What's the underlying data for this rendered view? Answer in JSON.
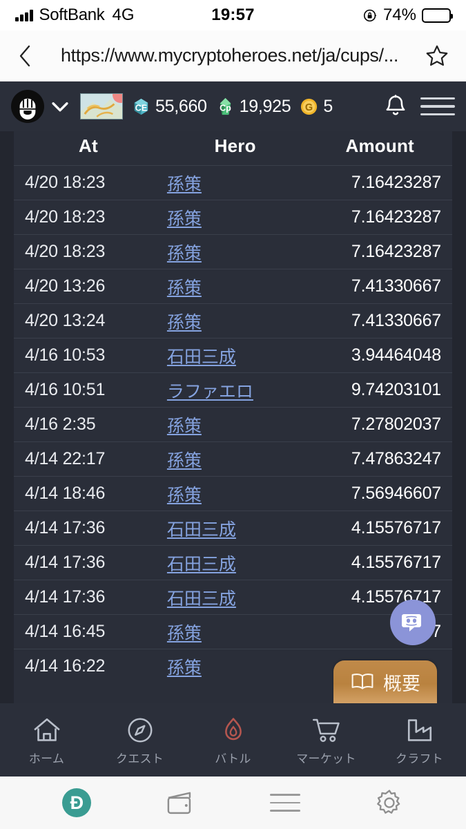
{
  "status_bar": {
    "carrier": "SoftBank",
    "network": "4G",
    "time": "19:57",
    "battery_percent": "74%"
  },
  "browser": {
    "url": "https://www.mycryptoheroes.net/ja/cups/...",
    "back_icon": "chevron-left-icon",
    "bookmark_icon": "star-icon",
    "toolbar": {
      "dapp_label": "Ð",
      "dapp_icon": "dapp-browser-icon",
      "wallet_icon": "wallet-icon",
      "menu_icon": "hamburger-menu-icon",
      "settings_icon": "gear-icon"
    }
  },
  "game_header": {
    "logo_icon": "mycryptoheroes-logo",
    "dropdown_icon": "chevron-down-icon",
    "map_thumb_icon": "land-thumbnail",
    "map_badge": "notification-dot",
    "currencies": [
      {
        "icon": "ce-crystal-icon",
        "code": "CE",
        "value": "55,660",
        "color": "#4fb5c6"
      },
      {
        "icon": "cp-crystal-icon",
        "code": "Cp",
        "value": "19,925",
        "color": "#4cbf7a"
      },
      {
        "icon": "gum-coin-icon",
        "code": "G",
        "value": "5",
        "color": "#f0b429"
      }
    ],
    "bell_icon": "notification-bell-icon",
    "menu_icon": "hamburger-menu-icon"
  },
  "table": {
    "columns": [
      "At",
      "Hero",
      "Amount"
    ],
    "rows": [
      {
        "at": "4/20 18:23",
        "hero": "孫策",
        "amount": "7.16423287"
      },
      {
        "at": "4/20 18:23",
        "hero": "孫策",
        "amount": "7.16423287"
      },
      {
        "at": "4/20 18:23",
        "hero": "孫策",
        "amount": "7.16423287"
      },
      {
        "at": "4/20 13:26",
        "hero": "孫策",
        "amount": "7.41330667"
      },
      {
        "at": "4/20 13:24",
        "hero": "孫策",
        "amount": "7.41330667"
      },
      {
        "at": "4/16 10:53",
        "hero": "石田三成",
        "amount": "3.94464048"
      },
      {
        "at": "4/16 10:51",
        "hero": "ラファエロ",
        "amount": "9.74203101"
      },
      {
        "at": "4/16 2:35",
        "hero": "孫策",
        "amount": "7.27802037"
      },
      {
        "at": "4/14 22:17",
        "hero": "孫策",
        "amount": "7.47863247"
      },
      {
        "at": "4/14 18:46",
        "hero": "孫策",
        "amount": "7.56946607"
      },
      {
        "at": "4/14 17:36",
        "hero": "石田三成",
        "amount": "4.15576717"
      },
      {
        "at": "4/14 17:36",
        "hero": "石田三成",
        "amount": "4.15576717"
      },
      {
        "at": "4/14 17:36",
        "hero": "石田三成",
        "amount": "4.15576717"
      },
      {
        "at": "4/14 16:45",
        "hero": "孫策",
        "amount": "7.687"
      },
      {
        "at": "4/14 16:22",
        "hero": "孫策",
        "amount": ""
      }
    ]
  },
  "floating": {
    "discord_icon": "discord-chat-icon",
    "overview_label": "概要",
    "overview_icon": "book-icon"
  },
  "game_nav": [
    {
      "icon": "home-icon",
      "label": "ホーム",
      "active": false
    },
    {
      "icon": "quest-icon",
      "label": "クエスト",
      "active": false
    },
    {
      "icon": "battle-icon",
      "label": "バトル",
      "active": true
    },
    {
      "icon": "market-icon",
      "label": "マーケット",
      "active": false
    },
    {
      "icon": "craft-icon",
      "label": "クラフト",
      "active": false
    }
  ],
  "colors": {
    "header_bg": "#2b2f3a",
    "page_bg": "#23262f",
    "row_bg": "#2a2e39",
    "link": "#85a3e0",
    "discord": "#8b94d8",
    "overview": "#b9823f",
    "battle_accent": "#b5564f",
    "dapp_teal": "#3a9c92"
  }
}
